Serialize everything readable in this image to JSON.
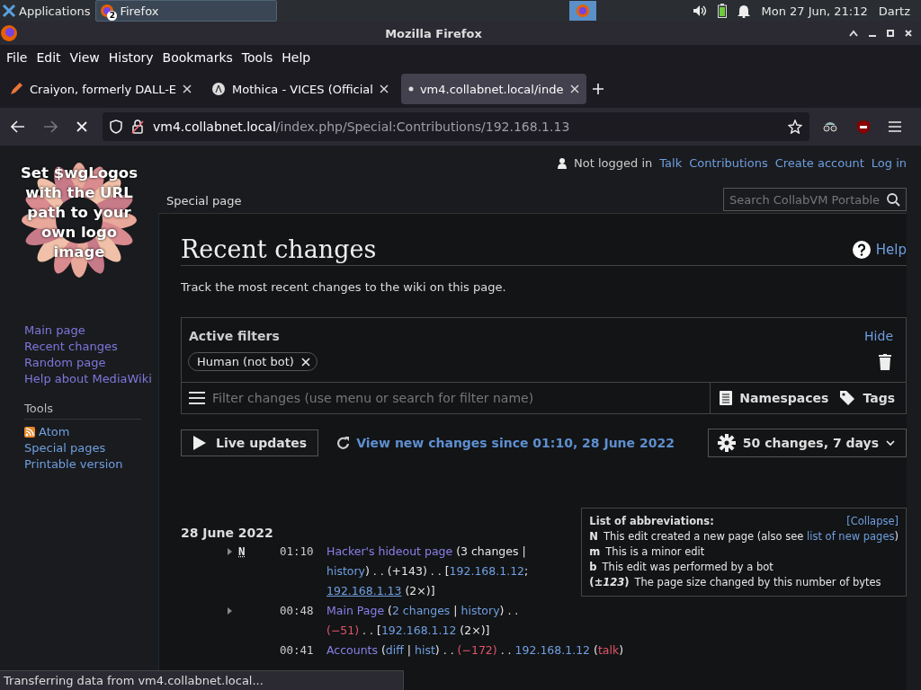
{
  "taskbar": {
    "apps_label": "Applications",
    "task": {
      "label": "Firefox",
      "badge": "2"
    },
    "clock": "Mon 27 Jun, 21:12",
    "user": "Dartz"
  },
  "window": {
    "title": "Mozilla Firefox"
  },
  "menu": [
    "File",
    "Edit",
    "View",
    "History",
    "Bookmarks",
    "Tools",
    "Help"
  ],
  "tabs": [
    {
      "label": "Craiyon, formerly DALL-E",
      "selected": false,
      "kind": "pencil"
    },
    {
      "label": "Mothica - VICES (Official",
      "selected": false,
      "kind": "circle"
    },
    {
      "label": "vm4.collabnet.local/inde",
      "selected": true,
      "kind": "loading"
    }
  ],
  "address": {
    "host": "vm4.collabnet.local",
    "path": "/index.php/Special:Contributions/192.168.1.13",
    "loading": true
  },
  "wiki": {
    "logo_text": "Set $wgLogos with the URL path to your own logo image",
    "personal": {
      "status": "Not logged in",
      "links": [
        "Talk",
        "Contributions",
        "Create account",
        "Log in"
      ]
    },
    "search": {
      "placeholder": "Search CollabVM Portable"
    },
    "namespace_tab": "Special page",
    "navigation": [
      "Main page",
      "Recent changes",
      "Random page",
      "Help about MediaWiki"
    ],
    "tools": {
      "heading": "Tools",
      "items": [
        {
          "label": "Atom",
          "kind": "feed"
        },
        {
          "label": "Special pages",
          "kind": "link"
        },
        {
          "label": "Printable version",
          "kind": "link"
        }
      ]
    },
    "heading": "Recent changes",
    "help": "Help",
    "intro": "Track the most recent changes to the wiki on this page.",
    "filters": {
      "title": "Active filters",
      "hide": "Hide",
      "chips": [
        "Human (not bot)"
      ],
      "placeholder": "Filter changes (use menu or search for filter name)",
      "namespaces": "Namespaces",
      "tags": "Tags"
    },
    "live_updates": "Live updates",
    "view_new": "View new changes since 01:10, 28 June 2022",
    "options": "50 changes, 7 days",
    "legend": {
      "title": "List of abbreviations:",
      "collapse": "[Collapse]",
      "entries": [
        {
          "key": "N",
          "text": "This edit created a new page (also see ",
          "link": "list of new pages",
          "after": ")"
        },
        {
          "key": "m",
          "text": "This is a minor edit"
        },
        {
          "key": "b",
          "text": "This edit was performed by a bot"
        },
        {
          "key": "(*±123*)",
          "text": "The page size changed by this number of bytes"
        }
      ]
    },
    "changes": {
      "date": "28 June 2022",
      "rows": [
        {
          "expandable": true,
          "flag": "N",
          "time": "01:10",
          "segments": [
            {
              "kind": "page",
              "text": "Hacker's hideout page"
            },
            {
              "kind": "text",
              "text": " (3 changes | "
            },
            {
              "kind": "link",
              "text": "history"
            },
            {
              "kind": "text",
              "text": ") . . (+143) . . ["
            },
            {
              "kind": "link",
              "text": "192.168.1.12"
            },
            {
              "kind": "text",
              "text": "; "
            },
            {
              "kind": "current",
              "text": "192.168.1.13"
            },
            {
              "kind": "text",
              "text": " (2×)]"
            }
          ]
        },
        {
          "expandable": true,
          "time": "00:48",
          "segments": [
            {
              "kind": "page",
              "text": "Main Page"
            },
            {
              "kind": "text",
              "text": " ("
            },
            {
              "kind": "link",
              "text": "2 changes"
            },
            {
              "kind": "text",
              "text": " | "
            },
            {
              "kind": "link",
              "text": "history"
            },
            {
              "kind": "text",
              "text": ") . . "
            },
            {
              "kind": "minus",
              "text": "(−51)"
            },
            {
              "kind": "text",
              "text": " . . ["
            },
            {
              "kind": "link",
              "text": "192.168.1.12"
            },
            {
              "kind": "text",
              "text": " (2×)]"
            }
          ]
        },
        {
          "expandable": false,
          "time": "00:41",
          "segments": [
            {
              "kind": "page",
              "text": "Accounts"
            },
            {
              "kind": "text",
              "text": " ("
            },
            {
              "kind": "link",
              "text": "diff"
            },
            {
              "kind": "text",
              "text": " | "
            },
            {
              "kind": "link",
              "text": "hist"
            },
            {
              "kind": "text",
              "text": ") . . "
            },
            {
              "kind": "minus",
              "text": "(−172)"
            },
            {
              "kind": "text",
              "text": " . . "
            },
            {
              "kind": "link",
              "text": "192.168.1.12"
            },
            {
              "kind": "text",
              "text": " ("
            },
            {
              "kind": "talk",
              "text": "talk"
            },
            {
              "kind": "text",
              "text": ")"
            }
          ]
        }
      ]
    }
  },
  "status_bar": "Transferring data from vm4.collabnet.local..."
}
